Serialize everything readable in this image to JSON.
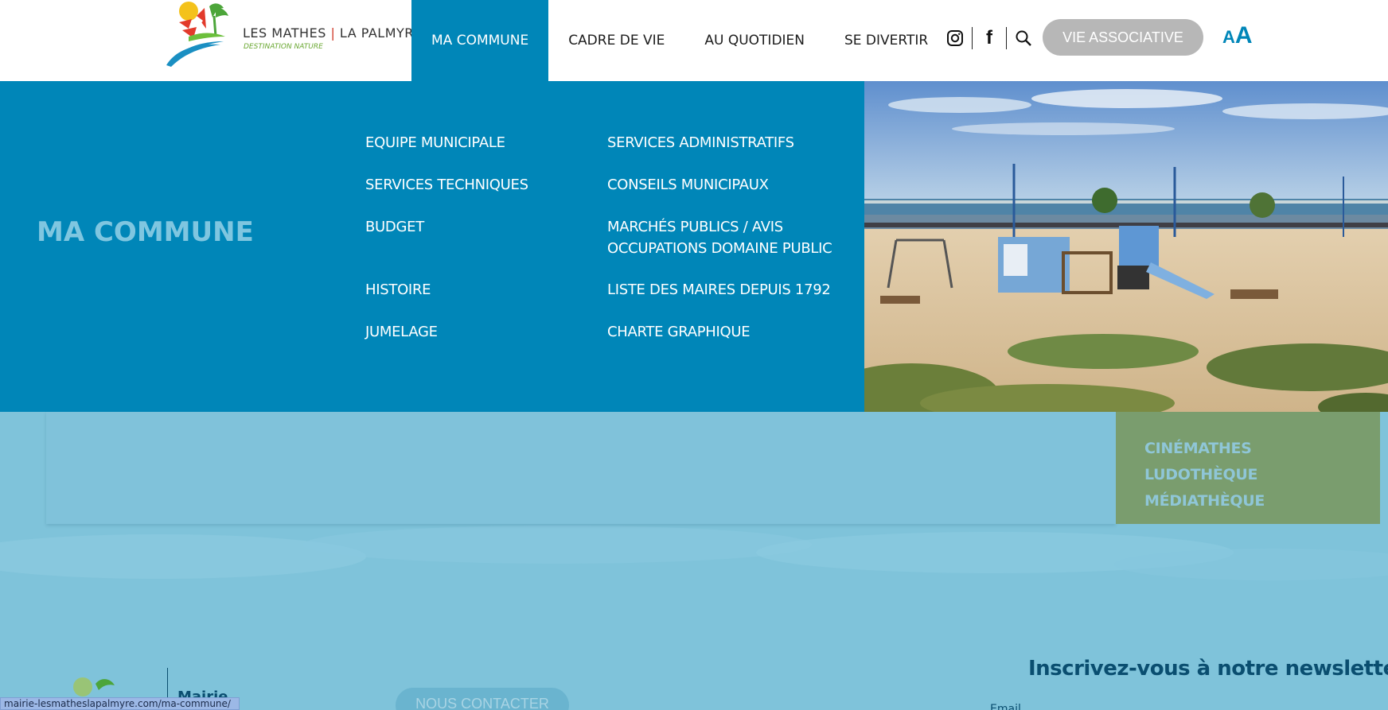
{
  "brand": {
    "title_left": "LES MATHES",
    "title_sep": "|",
    "title_right": "LA PALMYRE",
    "tagline": "DESTINATION NATURE"
  },
  "nav": {
    "items": [
      {
        "label": "MA COMMUNE",
        "active": true
      },
      {
        "label": "CADRE DE VIE",
        "active": false
      },
      {
        "label": "AU QUOTIDIEN",
        "active": false
      },
      {
        "label": "SE DIVERTIR",
        "active": false
      }
    ]
  },
  "header": {
    "social_icons": [
      "instagram-icon",
      "facebook-icon",
      "search-icon"
    ],
    "facebook_glyph": "f",
    "cta_label": "VIE ASSOCIATIVE",
    "font_size_toggle": {
      "small": "A",
      "big": "A"
    }
  },
  "mega_menu": {
    "title": "MA COMMUNE",
    "column_left": [
      "EQUIPE MUNICIPALE",
      "SERVICES TECHNIQUES",
      "BUDGET",
      "HISTOIRE",
      "JUMELAGE"
    ],
    "column_right": [
      "SERVICES ADMINISTRATIFS",
      "CONSEILS MUNICIPAUX",
      "MARCHÉS PUBLICS / AVIS",
      "OCCUPATIONS DOMAINE PUBLIC",
      "LISTE DES MAIRES DEPUIS 1792",
      "CHARTE GRAPHIQUE"
    ]
  },
  "quick_links": [
    "CINÉMATHES",
    "LUDOTHÈQUE",
    "MÉDIATHÈQUE"
  ],
  "footer": {
    "mairie_label": "Mairie",
    "contact_label": "NOUS CONTACTER",
    "newsletter_title": "Inscrivez-vous à notre newsletter",
    "email_label": "Email"
  },
  "status_bar": {
    "url": "mairie-lesmatheslapalmyre.com/ma-commune/"
  },
  "colors": {
    "primary_blue": "#0086b8",
    "light_blue": "#7fc3da",
    "green": "#7a9d6e",
    "dark_navy": "#0a4e70",
    "cta_grey": "#b7b7b7"
  }
}
